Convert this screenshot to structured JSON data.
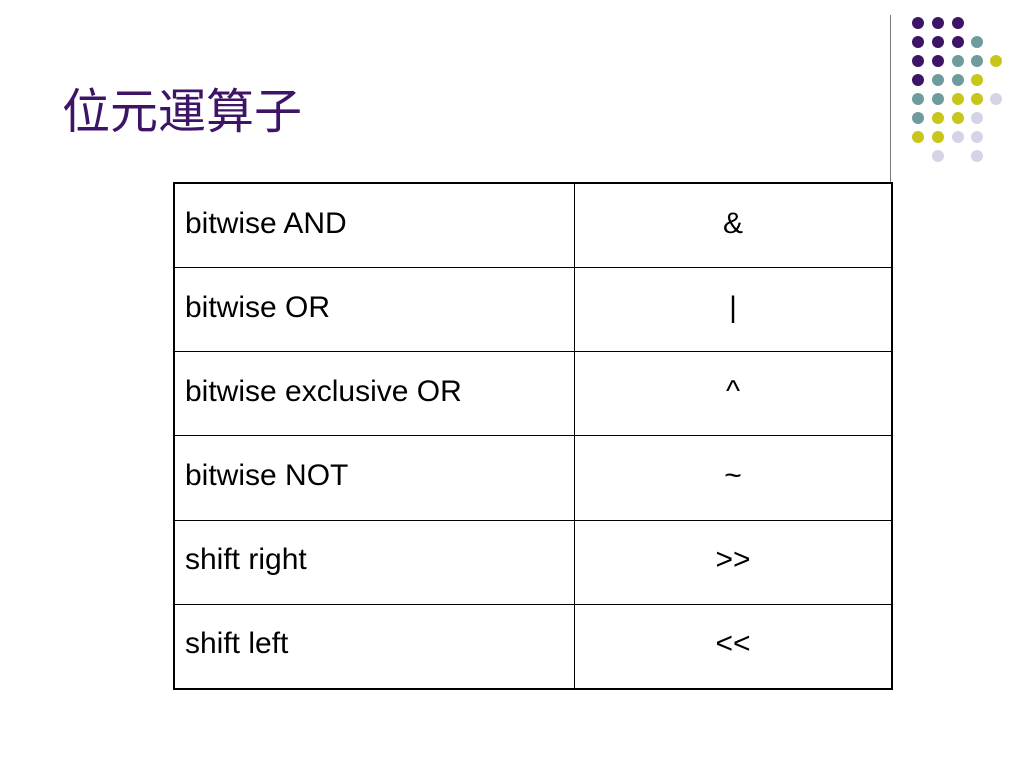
{
  "slide": {
    "title": "位元運算子"
  },
  "decor": {
    "colors": {
      "purple": "#3d1466",
      "teal": "#6e9b9d",
      "yellow": "#c7c61a",
      "lavender": "#d4d4e6",
      "line": "#7a7a7a"
    },
    "icon": "dot-grid-decoration"
  },
  "table": {
    "rows": [
      {
        "operation": "bitwise AND",
        "symbol": "&"
      },
      {
        "operation": "bitwise OR",
        "symbol": "|"
      },
      {
        "operation": "bitwise exclusive OR",
        "symbol": "^"
      },
      {
        "operation": "bitwise NOT",
        "symbol": "~"
      },
      {
        "operation": "shift right",
        "symbol": ">>"
      },
      {
        "operation": "shift left",
        "symbol": "<<"
      }
    ]
  }
}
